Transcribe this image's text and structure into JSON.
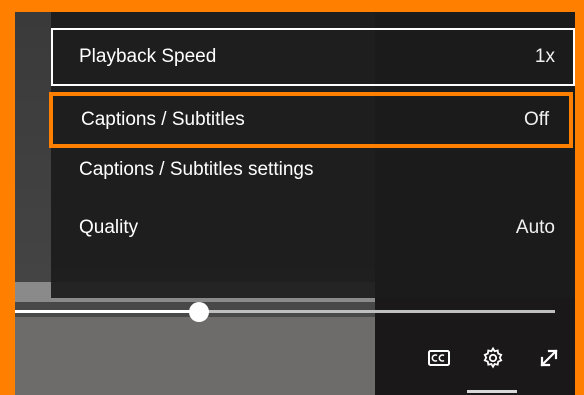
{
  "settings_menu": {
    "items": [
      {
        "label": "Playback Speed",
        "value": "1x"
      },
      {
        "label": "Captions / Subtitles",
        "value": "Off"
      },
      {
        "label": "Captions / Subtitles settings",
        "value": ""
      },
      {
        "label": "Quality",
        "value": "Auto"
      }
    ]
  },
  "player": {
    "progress_fraction": 0.33,
    "controls": [
      "cc-icon",
      "gear-icon",
      "fullscreen-icon"
    ]
  },
  "colors": {
    "highlight": "#ff7f00",
    "menu_bg": "#1c1c1c",
    "text": "#ffffff"
  }
}
